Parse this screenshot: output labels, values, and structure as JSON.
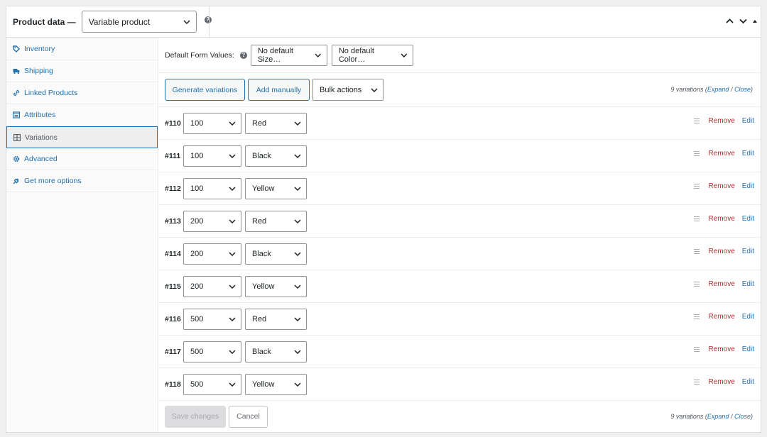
{
  "header": {
    "title": "Product data —",
    "product_type": "Variable product"
  },
  "sidebar": {
    "items": [
      {
        "label": "Inventory",
        "icon": "tag-icon",
        "active": false
      },
      {
        "label": "Shipping",
        "icon": "truck-icon",
        "active": false
      },
      {
        "label": "Linked Products",
        "icon": "link-icon",
        "active": false
      },
      {
        "label": "Attributes",
        "icon": "list-icon",
        "active": false
      },
      {
        "label": "Variations",
        "icon": "grid-icon",
        "active": true
      },
      {
        "label": "Advanced",
        "icon": "gear-icon",
        "active": false
      },
      {
        "label": "Get more options",
        "icon": "plugin-icon",
        "active": false
      }
    ]
  },
  "defaults": {
    "label": "Default Form Values:",
    "size": "No default Size…",
    "color": "No default Color…"
  },
  "toolbar": {
    "generate": "Generate variations",
    "add_manually": "Add manually",
    "bulk_actions": "Bulk actions",
    "count": "9 variations",
    "expand": "Expand",
    "sep": "/",
    "close": "Close"
  },
  "variations": [
    {
      "id": "#110",
      "size": "100",
      "color": "Red"
    },
    {
      "id": "#111",
      "size": "100",
      "color": "Black"
    },
    {
      "id": "#112",
      "size": "100",
      "color": "Yellow"
    },
    {
      "id": "#113",
      "size": "200",
      "color": "Red"
    },
    {
      "id": "#114",
      "size": "200",
      "color": "Black"
    },
    {
      "id": "#115",
      "size": "200",
      "color": "Yellow"
    },
    {
      "id": "#116",
      "size": "500",
      "color": "Red"
    },
    {
      "id": "#117",
      "size": "500",
      "color": "Black"
    },
    {
      "id": "#118",
      "size": "500",
      "color": "Yellow"
    }
  ],
  "row_actions": {
    "remove": "Remove",
    "edit": "Edit"
  },
  "footer": {
    "save": "Save changes",
    "cancel": "Cancel",
    "count": "9 variations",
    "expand": "Expand",
    "sep": "/",
    "close": "Close"
  },
  "colors": {
    "accent": "#2271b1",
    "danger": "#b32d2e"
  }
}
